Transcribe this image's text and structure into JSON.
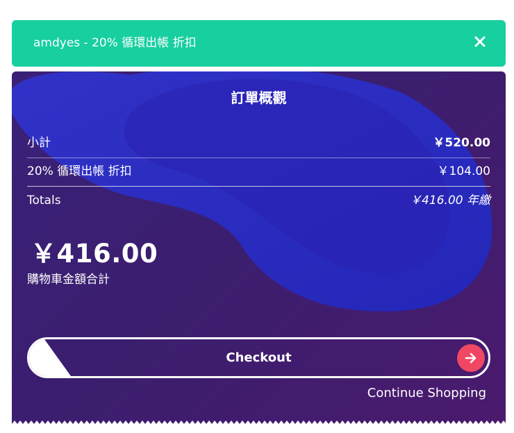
{
  "promo": {
    "text": "amdyes - 20% 循環出帳 折扣",
    "close_icon": "close-icon"
  },
  "summary": {
    "title": "訂單概觀",
    "subtotal_label": "小計",
    "subtotal_value": "￥520.00",
    "discount_label": "20% 循環出帳 折扣",
    "discount_value": "￥104.00",
    "totals_label": "Totals",
    "totals_value": "￥416.00 年繳",
    "total_amount": "￥416.00",
    "total_caption": "購物車金額合計"
  },
  "actions": {
    "checkout_label": "Checkout",
    "arrow_icon": "arrow-right-icon",
    "continue_label": "Continue Shopping"
  },
  "colors": {
    "promo_bg": "#17cf9f",
    "card_bg": "#3b1e6f",
    "blob": "#2b2fc9",
    "arrow_bg": "#f04862"
  }
}
